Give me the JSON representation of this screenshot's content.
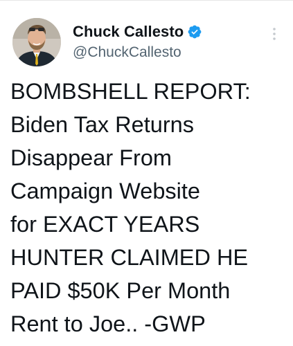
{
  "tweet": {
    "author": {
      "display_name": "Chuck Callesto",
      "handle": "@ChuckCallesto",
      "verified": true,
      "avatar_icon": "profile-photo"
    },
    "more_icon": "more-vertical-icon",
    "text_lines": [
      "BOMBSHELL REPORT:",
      "Biden Tax Returns",
      "Disappear From",
      "Campaign Website",
      "for EXACT YEARS",
      "HUNTER CLAIMED HE",
      "PAID $50K Per Month",
      "Rent to Joe.. -GWP"
    ]
  },
  "colors": {
    "text": "#0f1419",
    "secondary_text": "#536471",
    "verified_badge": "#1d9bf0",
    "background": "#ffffff"
  }
}
